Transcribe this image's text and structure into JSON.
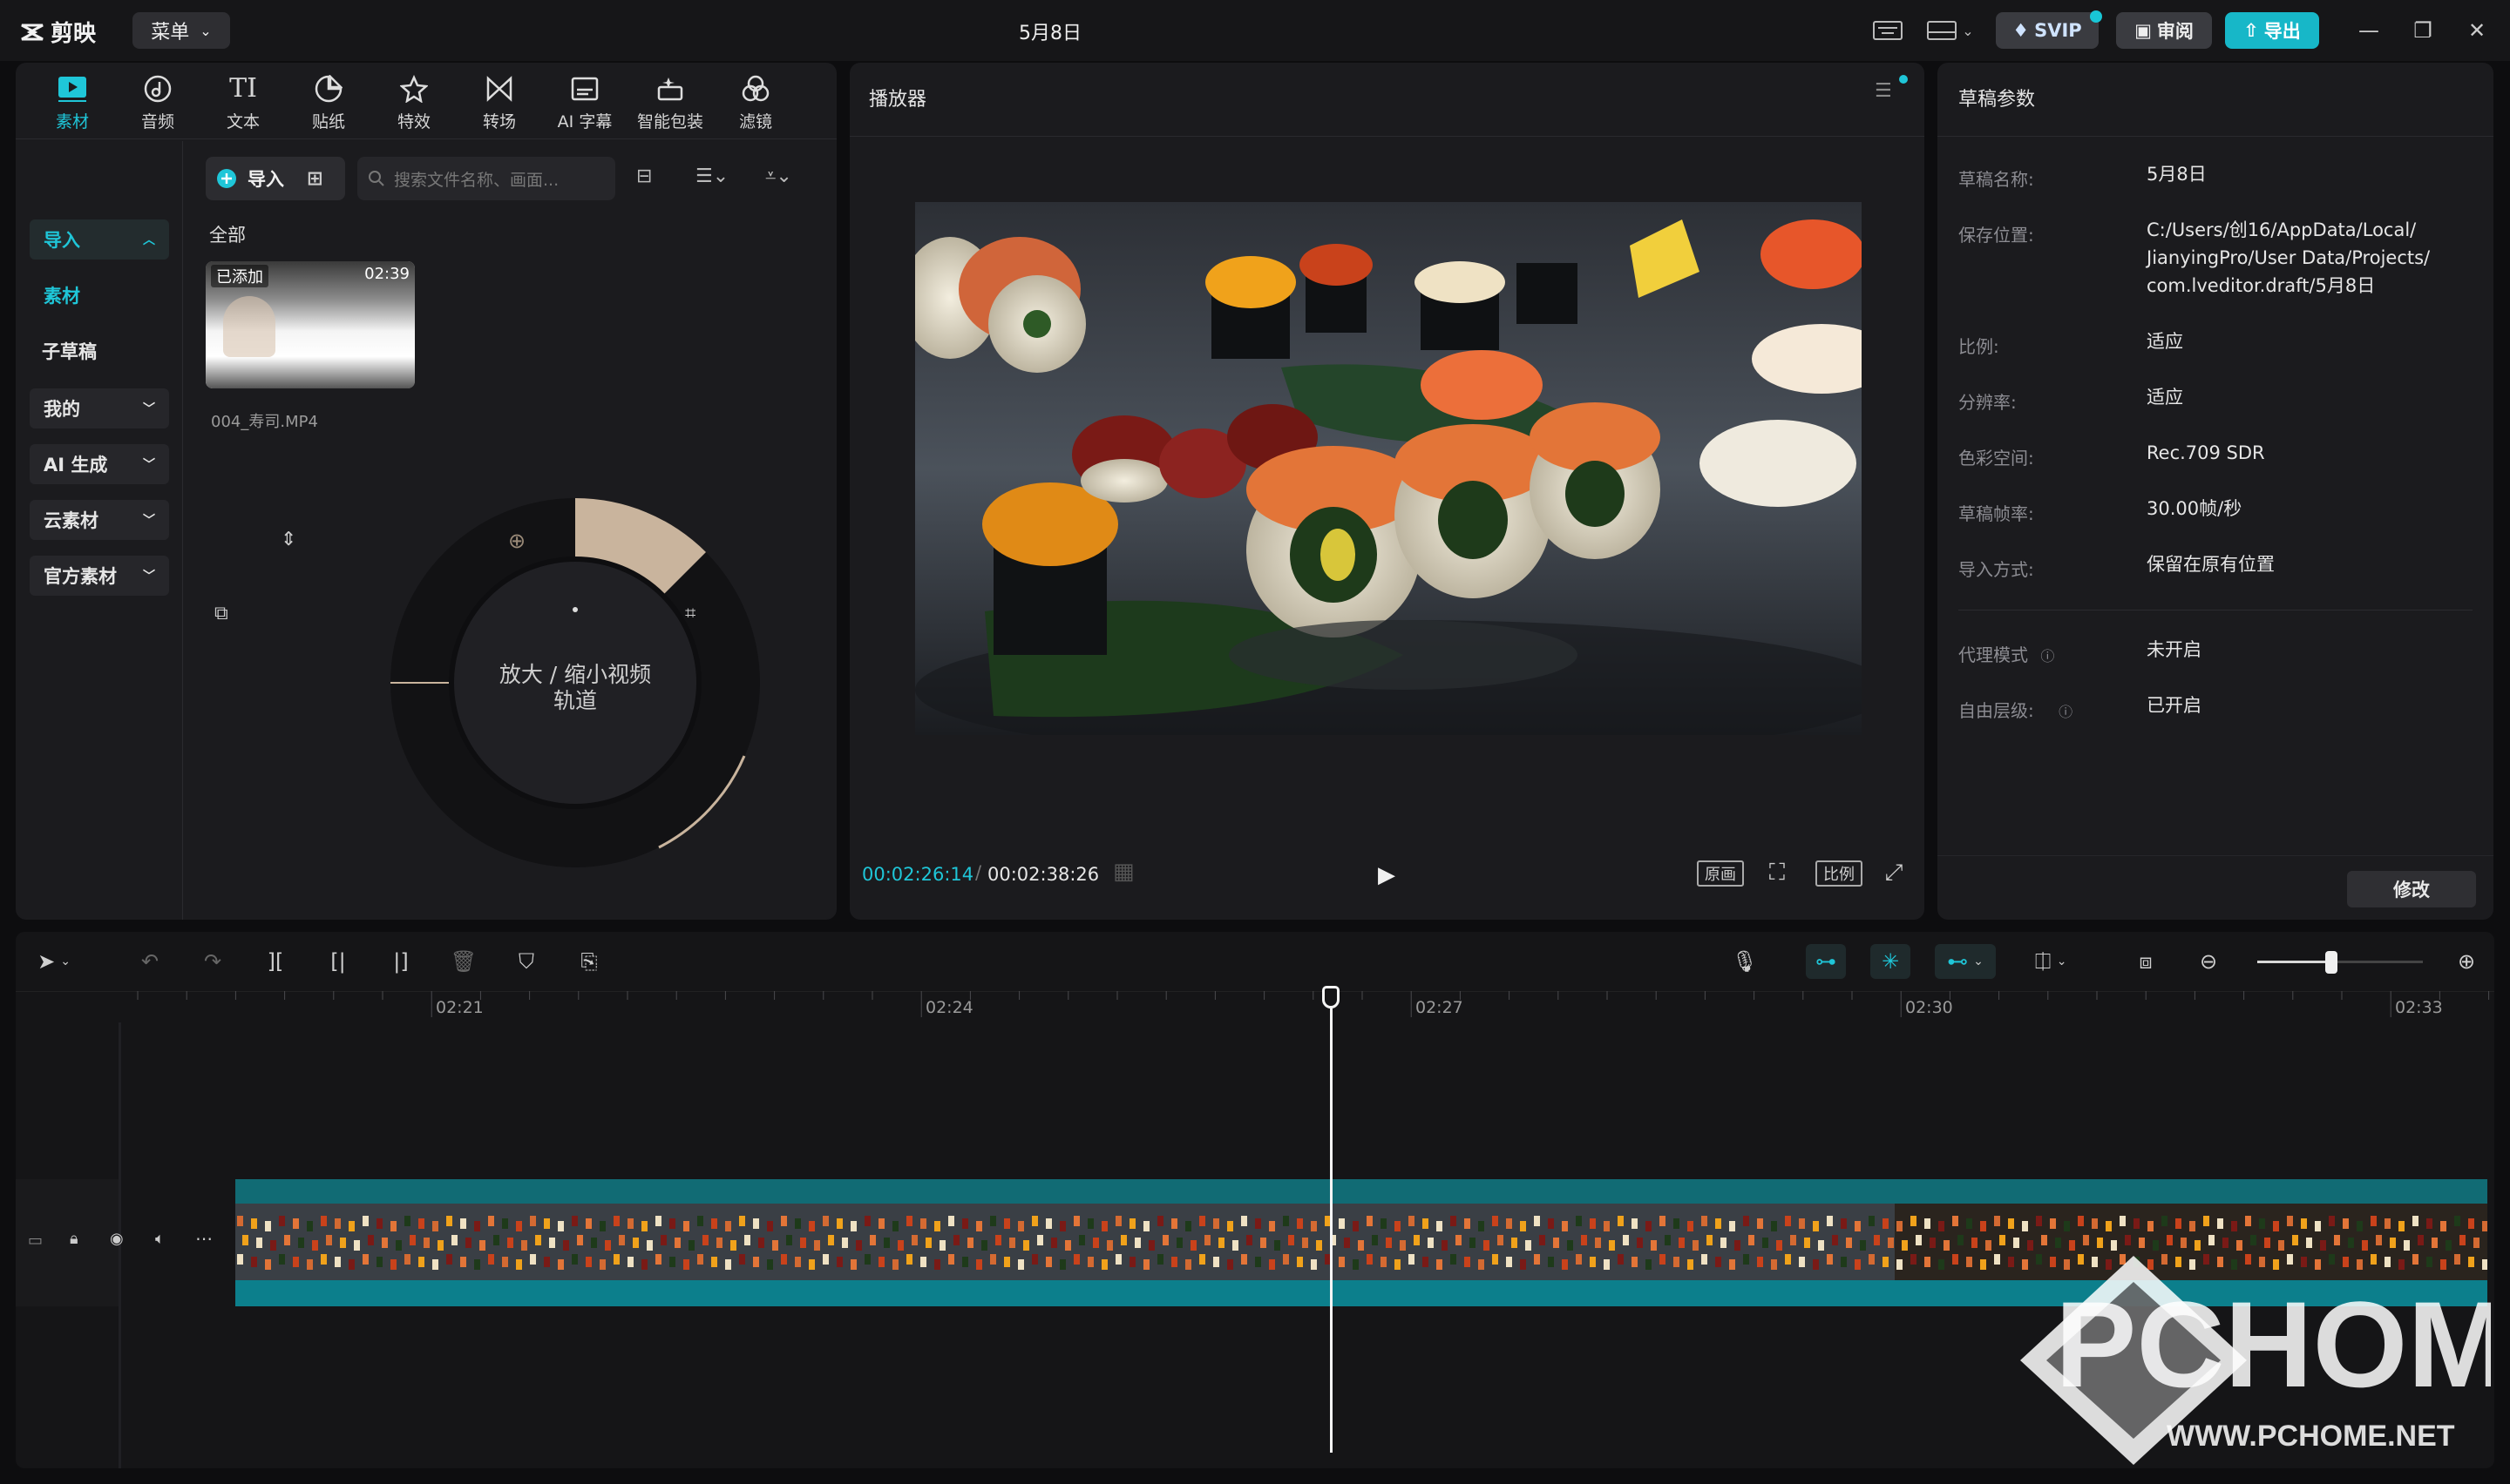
{
  "app": {
    "name": "剪映",
    "menu_label": "菜单",
    "project_title": "5月8日"
  },
  "titlebar": {
    "svip_label": "SVIP",
    "review_label": "审阅",
    "export_label": "导出"
  },
  "media_tabs": [
    {
      "label": "素材",
      "icon": "media-icon",
      "active": true
    },
    {
      "label": "音频",
      "icon": "audio-icon"
    },
    {
      "label": "文本",
      "icon": "text-icon",
      "glyph": "TI"
    },
    {
      "label": "贴纸",
      "icon": "sticker-icon"
    },
    {
      "label": "特效",
      "icon": "effects-icon"
    },
    {
      "label": "转场",
      "icon": "transition-icon"
    },
    {
      "label": "AI 字幕",
      "icon": "caption-icon"
    },
    {
      "label": "智能包装",
      "icon": "smart-pack-icon"
    },
    {
      "label": "滤镜",
      "icon": "filter-icon"
    }
  ],
  "sidebar": {
    "import_label": "导入",
    "media_label": "素材",
    "sub_draft_label": "子草稿",
    "mine_label": "我的",
    "ai_gen_label": "AI 生成",
    "cloud_label": "云素材",
    "official_label": "官方素材"
  },
  "library": {
    "import_button": "导入",
    "search_placeholder": "搜索文件名称、画面...",
    "all_label": "全部",
    "clip": {
      "badge": "已添加",
      "duration": "02:39",
      "filename": "004_寿司.MP4"
    }
  },
  "zoom_wheel": {
    "line1": "放大 / 缩小视频",
    "line2": "轨道"
  },
  "player": {
    "title": "播放器",
    "current_time": "00:02:26:14",
    "total_time": "00:02:38:26",
    "original_label": "原画",
    "ratio_label": "比例"
  },
  "properties": {
    "title": "草稿参数",
    "rows": [
      {
        "key": "草稿名称:",
        "value": "5月8日"
      },
      {
        "key": "保存位置:",
        "value_lines": [
          "C:/Users/创16/AppData/Local/",
          "JianyingPro/User Data/Projects/",
          "com.lveditor.draft/5月8日"
        ]
      },
      {
        "key": "比例:",
        "value": "适应"
      },
      {
        "key": "分辨率:",
        "value": "适应"
      },
      {
        "key": "色彩空间:",
        "value": "Rec.709 SDR"
      },
      {
        "key": "草稿帧率:",
        "value": "30.00帧/秒"
      },
      {
        "key": "导入方式:",
        "value": "保留在原有位置"
      },
      {
        "key": "代理模式",
        "value": "未开启"
      },
      {
        "key": "自由层级:",
        "value": "已开启"
      }
    ],
    "modify_label": "修改"
  },
  "timeline": {
    "ruler": [
      "02:21",
      "02:24",
      "02:27",
      "02:30",
      "02:33"
    ]
  },
  "watermark": {
    "brand": "PCHOME",
    "url": "WWW.PCHOME.NET"
  },
  "colors": {
    "accent": "#1fc6d8",
    "panel": "#1b1b1e",
    "clip": "#0f6f7a"
  }
}
